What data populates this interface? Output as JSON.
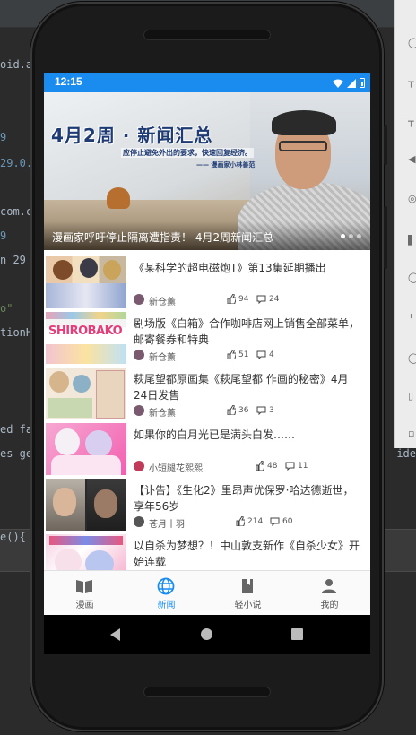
{
  "ide": {
    "code_fragments": [
      "oid.a",
      "9",
      "29.0.",
      "com.c",
      "9",
      "n 29",
      "o\"",
      "tionH",
      "ed fa",
      "es ge",
      "e(){",
      "ide",
      "ann"
    ]
  },
  "status_bar": {
    "time": "12:15"
  },
  "banner": {
    "image_title": "4月2周 · 新闻汇总",
    "image_subtitle": "应停止避免外出的要求，快速回复经济。",
    "image_credit": "—— 漫画家小林善范",
    "caption": "漫画家呼吁停止隔离遭指责！ 4月2周新闻汇总",
    "dots": 3,
    "active_dot": 0
  },
  "news": [
    {
      "title": "《某科学的超电磁炮T》第13集延期播出",
      "author": "新仓薰",
      "likes": "94",
      "comments": "24"
    },
    {
      "title": "剧场版《白箱》合作咖啡店网上销售全部菜单，邮寄餐券和特典",
      "author": "新仓薰",
      "likes": "51",
      "comments": "4",
      "thumb_text": "SHIROBAKO"
    },
    {
      "title": "萩尾望都原画集《萩尾望都 作画的秘密》4月24日发售",
      "author": "新仓薰",
      "likes": "36",
      "comments": "3"
    },
    {
      "title": "如果你的白月光已是满头白发……",
      "author": "小短腿花熙熙",
      "likes": "48",
      "comments": "11"
    },
    {
      "title": "【讣告】《生化2》里昂声优保罗·哈达德逝世，享年56岁",
      "author": "苍月十羽",
      "likes": "214",
      "comments": "60"
    },
    {
      "title": "以自杀为梦想？！中山敦支新作《自杀少女》开始连载",
      "author": "",
      "likes": "",
      "comments": ""
    }
  ],
  "bottom_nav": [
    {
      "label": "漫画",
      "icon": "book-open-icon",
      "active": false
    },
    {
      "label": "新闻",
      "icon": "globe-icon",
      "active": true
    },
    {
      "label": "轻小说",
      "icon": "book-icon",
      "active": false
    },
    {
      "label": "我的",
      "icon": "person-icon",
      "active": false
    }
  ],
  "colors": {
    "accent": "#1a8cf0",
    "status_bar": "#1a8cf0"
  }
}
